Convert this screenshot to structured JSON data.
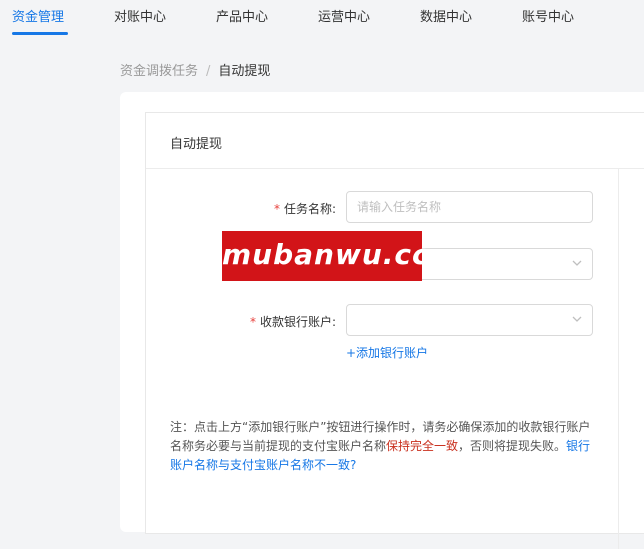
{
  "nav": {
    "tabs": [
      {
        "label": "资金管理",
        "active": true
      },
      {
        "label": "对账中心"
      },
      {
        "label": "产品中心"
      },
      {
        "label": "运营中心"
      },
      {
        "label": "数据中心"
      },
      {
        "label": "账号中心"
      }
    ]
  },
  "breadcrumb": {
    "parent": "资金调拨任务",
    "separator": "/",
    "current": "自动提现"
  },
  "panel": {
    "title": "自动提现"
  },
  "form": {
    "required_mark": "*",
    "task_name": {
      "label": "任务名称:",
      "placeholder": "请输入任务名称",
      "value": ""
    },
    "select2": {
      "label": "",
      "value": ""
    },
    "bank_account": {
      "label": "收款银行账户:",
      "value": ""
    },
    "add_bank_link": "+添加银行账户"
  },
  "note": {
    "part1": "注：点击上方“添加银行账户”按钮进行操作时，请务必确保添加的收款银行账户名称务必要与当前提现的支付宝账户名称",
    "highlight": "保持完全一致",
    "part2": "，否则将提现失败。",
    "link": "银行账户名称与支付宝账户名称不一致?"
  },
  "watermark": {
    "text": "mubanwu.cc"
  },
  "icons": {
    "chevron": "chevron-down-icon"
  },
  "colors": {
    "accent": "#1677e6",
    "required": "#e8413c",
    "warning_text": "#c9301e",
    "watermark_bg": "#d21418"
  }
}
